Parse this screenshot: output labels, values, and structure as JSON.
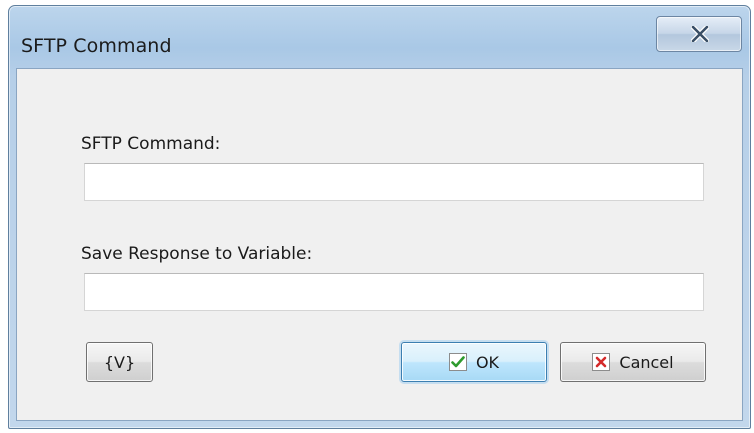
{
  "window": {
    "title": "SFTP Command",
    "close_glyph": "X"
  },
  "form": {
    "command_label": "SFTP Command:",
    "command_value": "",
    "response_label": "Save Response to Variable:",
    "response_value": ""
  },
  "buttons": {
    "variables_label": "{V}",
    "ok_label": "OK",
    "cancel_label": "Cancel"
  },
  "icons": {
    "close": "close-icon",
    "ok": "checkmark-icon",
    "cancel": "x-mark-icon"
  },
  "colors": {
    "check_green": "#2e9b2e",
    "cancel_red": "#d42a2a",
    "dialog_background": "#f0f0f0",
    "frame_blue": "#a9c8e6"
  }
}
